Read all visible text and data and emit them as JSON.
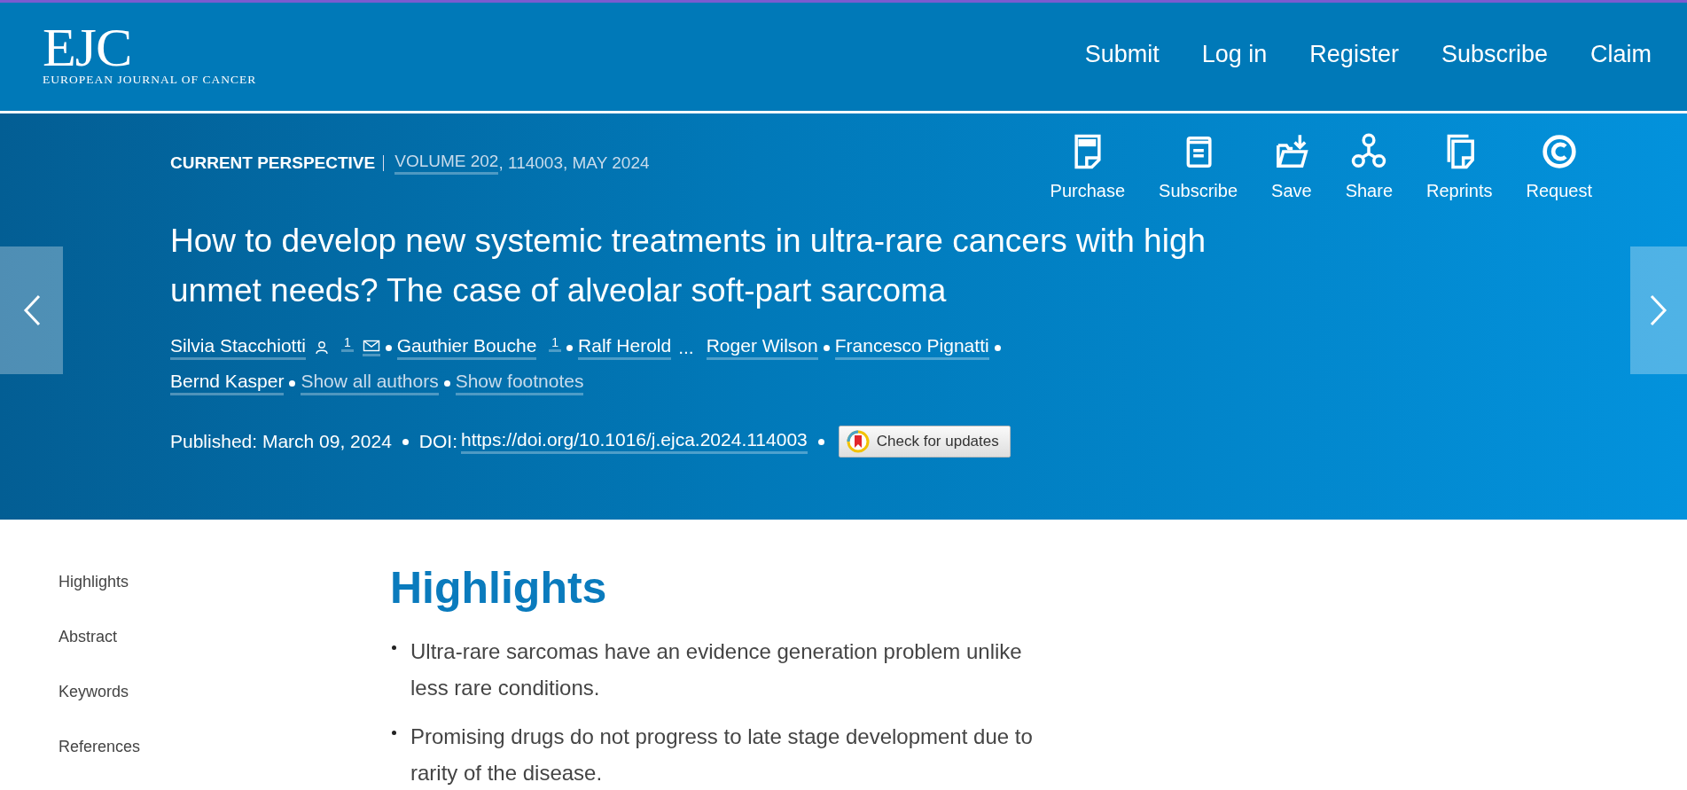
{
  "header": {
    "logo": "EJC",
    "logo_subtitle": "EUROPEAN JOURNAL OF CANCER",
    "nav": [
      "Submit",
      "Log in",
      "Register",
      "Subscribe",
      "Claim"
    ]
  },
  "article": {
    "type": "CURRENT PERSPECTIVE",
    "volume": "VOLUME 202",
    "issue": ", 114003, MAY 2024",
    "title": "How to develop new systemic treatments in ultra-rare cancers with high unmet needs? The case of alveolar soft-part sarcoma",
    "authors": [
      {
        "kind": "author",
        "name": "Silvia Stacchiotti",
        "sup": "1",
        "corresponding": true
      },
      {
        "kind": "author",
        "name": "Gauthier Bouche",
        "sup": "1",
        "corresponding": false
      },
      {
        "kind": "author",
        "name": "Ralf Herold",
        "corresponding": false
      },
      {
        "kind": "ellipsis",
        "name": "..."
      },
      {
        "kind": "author",
        "name": "Roger Wilson",
        "corresponding": false
      },
      {
        "kind": "author",
        "name": "Francesco Pignatti",
        "corresponding": false
      },
      {
        "kind": "author",
        "name": "Bernd Kasper",
        "corresponding": false
      },
      {
        "kind": "link",
        "name": "Show all authors"
      },
      {
        "kind": "link",
        "name": "Show footnotes"
      }
    ],
    "published": "Published: March 09, 2024",
    "doi_label": "DOI:",
    "doi": "https://doi.org/10.1016/j.ejca.2024.114003",
    "updates_button": "Check for updates",
    "actions": [
      {
        "kind": "pdf",
        "label": "Purchase"
      },
      {
        "kind": "book",
        "label": "Subscribe"
      },
      {
        "kind": "folder",
        "label": "Save"
      },
      {
        "kind": "share",
        "label": "Share"
      },
      {
        "kind": "pages",
        "label": "Reprints"
      },
      {
        "kind": "copyright",
        "label": "Request"
      }
    ]
  },
  "sidebar": {
    "items": [
      "Highlights",
      "Abstract",
      "Keywords",
      "References"
    ]
  },
  "highlights": {
    "heading": "Highlights",
    "items": [
      "Ultra-rare sarcomas have an evidence generation problem unlike less rare conditions.",
      "Promising drugs do not progress to late stage development due to rarity of the disease."
    ]
  }
}
